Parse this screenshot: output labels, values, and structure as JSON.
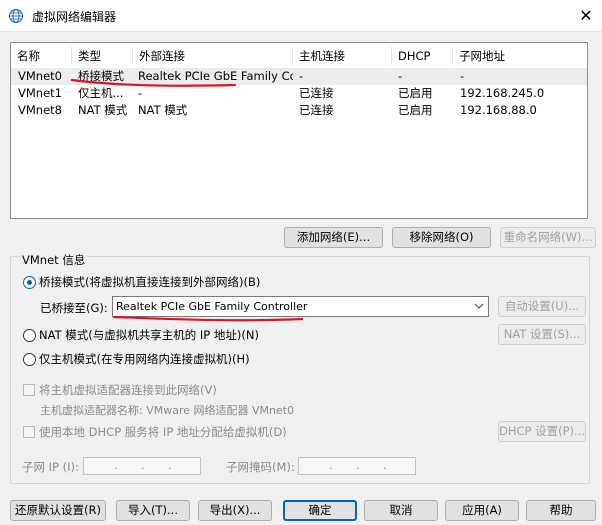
{
  "window": {
    "title": "虚拟网络编辑器",
    "close_glyph": "✕"
  },
  "table": {
    "headers": [
      "名称",
      "类型",
      "外部连接",
      "主机连接",
      "DHCP",
      "子网地址"
    ],
    "rows": [
      [
        "VMnet0",
        "桥接模式",
        "Realtek PCIe GbE Family Co...",
        "-",
        "-",
        "-"
      ],
      [
        "VMnet1",
        "仅主机...",
        "-",
        "已连接",
        "已启用",
        "192.168.245.0"
      ],
      [
        "VMnet8",
        "NAT 模式",
        "NAT 模式",
        "已连接",
        "已启用",
        "192.168.88.0"
      ]
    ],
    "selected_row": 0
  },
  "table_buttons": {
    "add": "添加网络(E)...",
    "remove": "移除网络(O)",
    "rename": "重命名网络(W)..."
  },
  "vmnet_info": {
    "title": "VMnet 信息",
    "bridged": "桥接模式(将虚拟机直接连接到外部网络)(B)",
    "bridged_to_label": "已桥接至(G):",
    "bridged_to_value": "Realtek PCIe GbE Family Controller",
    "auto_settings": "自动设置(U)...",
    "nat": "NAT 模式(与虚拟机共享主机的 IP 地址)(N)",
    "nat_settings": "NAT 设置(S)...",
    "host_only": "仅主机模式(在专用网络内连接虚拟机)(H)",
    "connect_adapter": "将主机虚拟适配器连接到此网络(V)",
    "adapter_name": "主机虚拟适配器名称: VMware 网络适配器 VMnet0",
    "use_dhcp": "使用本地 DHCP 服务将 IP 地址分配给虚拟机(D)",
    "dhcp_settings": "DHCP 设置(P)...",
    "subnet_ip_label": "子网 IP (I):",
    "subnet_mask_label": "子网掩码(M):",
    "ip_dots": ".",
    "selected_mode": "bridged"
  },
  "footer": {
    "restore": "还原默认设置(R)",
    "import": "导入(T)...",
    "export": "导出(X)...",
    "ok": "确定",
    "cancel": "取消",
    "apply": "应用(A)",
    "help": "帮助"
  },
  "colors": {
    "accent": "#0067c0",
    "annotation": "#e0141e",
    "disabled_text": "#8a8a8a"
  },
  "icons": {
    "app": "network-globe-icon",
    "close": "close-icon",
    "dropdown": "chevron-down-icon"
  }
}
